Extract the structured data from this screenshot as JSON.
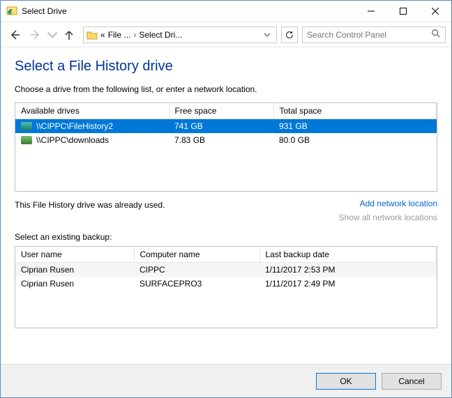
{
  "window": {
    "title": "Select Drive"
  },
  "breadcrumbs": {
    "p0": "«",
    "p1": "File ...",
    "p2": "Select Dri..."
  },
  "search": {
    "placeholder": "Search Control Panel"
  },
  "page": {
    "heading": "Select a File History drive",
    "subtitle": "Choose a drive from the following list, or enter a network location.",
    "status": "This File History drive was already used.",
    "add_link": "Add network location",
    "show_all_link": "Show all network locations",
    "backup_label": "Select an existing backup:"
  },
  "drives": {
    "cols": {
      "c0": "Available drives",
      "c1": "Free space",
      "c2": "Total space"
    },
    "rows": [
      {
        "name": "\\\\CIPPC\\FileHistory2",
        "free": "741 GB",
        "total": "931 GB"
      },
      {
        "name": "\\\\CIPPC\\downloads",
        "free": "7.83 GB",
        "total": "80.0 GB"
      }
    ]
  },
  "backups": {
    "cols": {
      "c0": "User name",
      "c1": "Computer name",
      "c2": "Last backup date"
    },
    "rows": [
      {
        "user": "Ciprian Rusen",
        "computer": "CIPPC",
        "date": "1/11/2017 2:53 PM"
      },
      {
        "user": "Ciprian Rusen",
        "computer": "SURFACEPRO3",
        "date": "1/11/2017 2:49 PM"
      }
    ]
  },
  "buttons": {
    "ok": "OK",
    "cancel": "Cancel"
  }
}
